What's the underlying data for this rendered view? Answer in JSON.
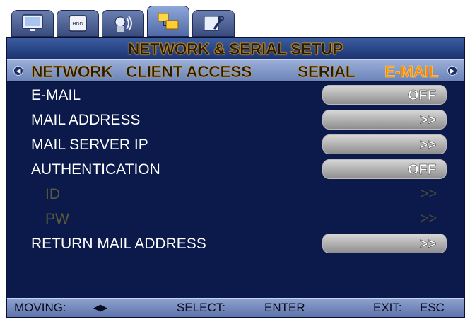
{
  "tabs": [
    {
      "name": "monitor-icon"
    },
    {
      "name": "hdd-icon",
      "text": "HDD"
    },
    {
      "name": "camera-record-icon"
    },
    {
      "name": "network-icon"
    },
    {
      "name": "system-tools-icon"
    }
  ],
  "title": "NETWORK & SERIAL SETUP",
  "subtabs": [
    "NETWORK",
    "CLIENT ACCESS",
    "SERIAL",
    "E-MAIL"
  ],
  "rows": [
    {
      "label": "E-MAIL",
      "value": "OFF"
    },
    {
      "label": "MAIL ADDRESS",
      "value": ">>"
    },
    {
      "label": "MAIL SERVER IP",
      "value": ">>"
    },
    {
      "label": "AUTHENTICATION",
      "value": "OFF"
    },
    {
      "label": "ID",
      "value": ">>"
    },
    {
      "label": "PW",
      "value": ">>"
    },
    {
      "label": "RETURN MAIL ADDRESS",
      "value": ">>"
    }
  ],
  "footer": {
    "moving": "MOVING:",
    "moving_icon": "◀▶",
    "select": "SELECT:",
    "enter": "ENTER",
    "exit": "EXIT:",
    "esc": "ESC"
  },
  "colors": {
    "background": "#0b1a4a",
    "active_subtab": "#ff8a00",
    "value_box": "#a8a8a8"
  }
}
